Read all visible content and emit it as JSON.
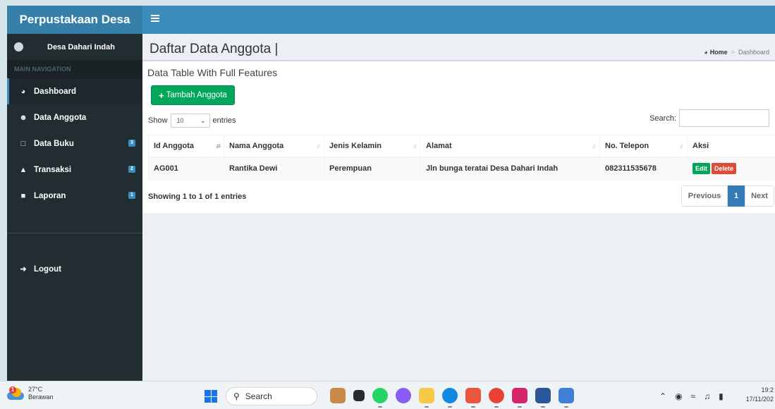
{
  "app": {
    "title": "Perpustakaan Desa"
  },
  "sidebar": {
    "user_name": "Desa Dahari Indah",
    "nav_header": "MAIN NAVIGATION",
    "items": [
      {
        "label": "Dashboard",
        "icon": "dashboard-icon",
        "active": true
      },
      {
        "label": "Data Anggota",
        "icon": "users-icon"
      },
      {
        "label": "Data Buku",
        "icon": "laptop-icon",
        "badge": "3"
      },
      {
        "label": "Transaksi",
        "icon": "area-chart-icon",
        "badge": "2"
      },
      {
        "label": "Laporan",
        "icon": "file-icon",
        "badge": "1"
      }
    ],
    "logout_label": "Logout"
  },
  "header": {
    "page_title": "Daftar Data Anggota |",
    "breadcrumb_home": "Home",
    "breadcrumb_separator": ">",
    "breadcrumb_current": "Dashboard"
  },
  "box": {
    "title": "Data Table With Full Features",
    "add_button_label": "Tambah Anggota",
    "show_label": "Show",
    "entries_value": "10",
    "entries_label": "entries",
    "search_label": "Search:",
    "search_value": ""
  },
  "table": {
    "columns": [
      "Id Anggota",
      "Nama Anggota",
      "Jenis Kelamin",
      "Alamat",
      "No. Telepon",
      "Aksi"
    ],
    "rows": [
      {
        "id": "AG001",
        "nama": "Rantika Dewi",
        "jk": "Perempuan",
        "alamat": "Jln bunga teratai Desa Dahari Indah",
        "telepon": "082311535678",
        "edit": "Edit",
        "delete": "Delete"
      }
    ],
    "info": "Showing 1 to 1 of 1 entries",
    "pagination": {
      "previous": "Previous",
      "current": "1",
      "next": "Next"
    }
  },
  "taskbar": {
    "temperature": "27°C",
    "weather": "Berawan",
    "weather_badge": "1",
    "search_placeholder": "Search",
    "time": "19:2",
    "date": "17/11/202"
  },
  "colors": {
    "header_blue": "#3c8dbc",
    "logo_blue": "#367fa9",
    "sidebar_dark": "#222d32",
    "green": "#00a65a",
    "red": "#dd4b39",
    "page_blue": "#337ab7"
  }
}
